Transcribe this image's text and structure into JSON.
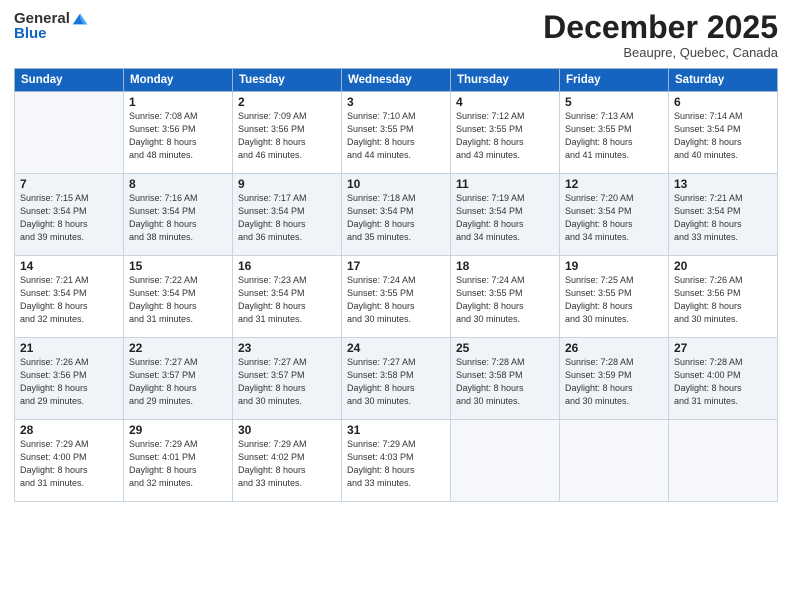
{
  "header": {
    "logo_general": "General",
    "logo_blue": "Blue",
    "month": "December 2025",
    "location": "Beaupre, Quebec, Canada"
  },
  "days": [
    "Sunday",
    "Monday",
    "Tuesday",
    "Wednesday",
    "Thursday",
    "Friday",
    "Saturday"
  ],
  "weeks": [
    [
      {
        "day": "",
        "sunrise": "",
        "sunset": "",
        "daylight": ""
      },
      {
        "day": "1",
        "sunrise": "Sunrise: 7:08 AM",
        "sunset": "Sunset: 3:56 PM",
        "daylight": "Daylight: 8 hours and 48 minutes."
      },
      {
        "day": "2",
        "sunrise": "Sunrise: 7:09 AM",
        "sunset": "Sunset: 3:56 PM",
        "daylight": "Daylight: 8 hours and 46 minutes."
      },
      {
        "day": "3",
        "sunrise": "Sunrise: 7:10 AM",
        "sunset": "Sunset: 3:55 PM",
        "daylight": "Daylight: 8 hours and 44 minutes."
      },
      {
        "day": "4",
        "sunrise": "Sunrise: 7:12 AM",
        "sunset": "Sunset: 3:55 PM",
        "daylight": "Daylight: 8 hours and 43 minutes."
      },
      {
        "day": "5",
        "sunrise": "Sunrise: 7:13 AM",
        "sunset": "Sunset: 3:55 PM",
        "daylight": "Daylight: 8 hours and 41 minutes."
      },
      {
        "day": "6",
        "sunrise": "Sunrise: 7:14 AM",
        "sunset": "Sunset: 3:54 PM",
        "daylight": "Daylight: 8 hours and 40 minutes."
      }
    ],
    [
      {
        "day": "7",
        "sunrise": "Sunrise: 7:15 AM",
        "sunset": "Sunset: 3:54 PM",
        "daylight": "Daylight: 8 hours and 39 minutes."
      },
      {
        "day": "8",
        "sunrise": "Sunrise: 7:16 AM",
        "sunset": "Sunset: 3:54 PM",
        "daylight": "Daylight: 8 hours and 38 minutes."
      },
      {
        "day": "9",
        "sunrise": "Sunrise: 7:17 AM",
        "sunset": "Sunset: 3:54 PM",
        "daylight": "Daylight: 8 hours and 36 minutes."
      },
      {
        "day": "10",
        "sunrise": "Sunrise: 7:18 AM",
        "sunset": "Sunset: 3:54 PM",
        "daylight": "Daylight: 8 hours and 35 minutes."
      },
      {
        "day": "11",
        "sunrise": "Sunrise: 7:19 AM",
        "sunset": "Sunset: 3:54 PM",
        "daylight": "Daylight: 8 hours and 34 minutes."
      },
      {
        "day": "12",
        "sunrise": "Sunrise: 7:20 AM",
        "sunset": "Sunset: 3:54 PM",
        "daylight": "Daylight: 8 hours and 34 minutes."
      },
      {
        "day": "13",
        "sunrise": "Sunrise: 7:21 AM",
        "sunset": "Sunset: 3:54 PM",
        "daylight": "Daylight: 8 hours and 33 minutes."
      }
    ],
    [
      {
        "day": "14",
        "sunrise": "Sunrise: 7:21 AM",
        "sunset": "Sunset: 3:54 PM",
        "daylight": "Daylight: 8 hours and 32 minutes."
      },
      {
        "day": "15",
        "sunrise": "Sunrise: 7:22 AM",
        "sunset": "Sunset: 3:54 PM",
        "daylight": "Daylight: 8 hours and 31 minutes."
      },
      {
        "day": "16",
        "sunrise": "Sunrise: 7:23 AM",
        "sunset": "Sunset: 3:54 PM",
        "daylight": "Daylight: 8 hours and 31 minutes."
      },
      {
        "day": "17",
        "sunrise": "Sunrise: 7:24 AM",
        "sunset": "Sunset: 3:55 PM",
        "daylight": "Daylight: 8 hours and 30 minutes."
      },
      {
        "day": "18",
        "sunrise": "Sunrise: 7:24 AM",
        "sunset": "Sunset: 3:55 PM",
        "daylight": "Daylight: 8 hours and 30 minutes."
      },
      {
        "day": "19",
        "sunrise": "Sunrise: 7:25 AM",
        "sunset": "Sunset: 3:55 PM",
        "daylight": "Daylight: 8 hours and 30 minutes."
      },
      {
        "day": "20",
        "sunrise": "Sunrise: 7:26 AM",
        "sunset": "Sunset: 3:56 PM",
        "daylight": "Daylight: 8 hours and 30 minutes."
      }
    ],
    [
      {
        "day": "21",
        "sunrise": "Sunrise: 7:26 AM",
        "sunset": "Sunset: 3:56 PM",
        "daylight": "Daylight: 8 hours and 29 minutes."
      },
      {
        "day": "22",
        "sunrise": "Sunrise: 7:27 AM",
        "sunset": "Sunset: 3:57 PM",
        "daylight": "Daylight: 8 hours and 29 minutes."
      },
      {
        "day": "23",
        "sunrise": "Sunrise: 7:27 AM",
        "sunset": "Sunset: 3:57 PM",
        "daylight": "Daylight: 8 hours and 30 minutes."
      },
      {
        "day": "24",
        "sunrise": "Sunrise: 7:27 AM",
        "sunset": "Sunset: 3:58 PM",
        "daylight": "Daylight: 8 hours and 30 minutes."
      },
      {
        "day": "25",
        "sunrise": "Sunrise: 7:28 AM",
        "sunset": "Sunset: 3:58 PM",
        "daylight": "Daylight: 8 hours and 30 minutes."
      },
      {
        "day": "26",
        "sunrise": "Sunrise: 7:28 AM",
        "sunset": "Sunset: 3:59 PM",
        "daylight": "Daylight: 8 hours and 30 minutes."
      },
      {
        "day": "27",
        "sunrise": "Sunrise: 7:28 AM",
        "sunset": "Sunset: 4:00 PM",
        "daylight": "Daylight: 8 hours and 31 minutes."
      }
    ],
    [
      {
        "day": "28",
        "sunrise": "Sunrise: 7:29 AM",
        "sunset": "Sunset: 4:00 PM",
        "daylight": "Daylight: 8 hours and 31 minutes."
      },
      {
        "day": "29",
        "sunrise": "Sunrise: 7:29 AM",
        "sunset": "Sunset: 4:01 PM",
        "daylight": "Daylight: 8 hours and 32 minutes."
      },
      {
        "day": "30",
        "sunrise": "Sunrise: 7:29 AM",
        "sunset": "Sunset: 4:02 PM",
        "daylight": "Daylight: 8 hours and 33 minutes."
      },
      {
        "day": "31",
        "sunrise": "Sunrise: 7:29 AM",
        "sunset": "Sunset: 4:03 PM",
        "daylight": "Daylight: 8 hours and 33 minutes."
      },
      {
        "day": "",
        "sunrise": "",
        "sunset": "",
        "daylight": ""
      },
      {
        "day": "",
        "sunrise": "",
        "sunset": "",
        "daylight": ""
      },
      {
        "day": "",
        "sunrise": "",
        "sunset": "",
        "daylight": ""
      }
    ]
  ]
}
